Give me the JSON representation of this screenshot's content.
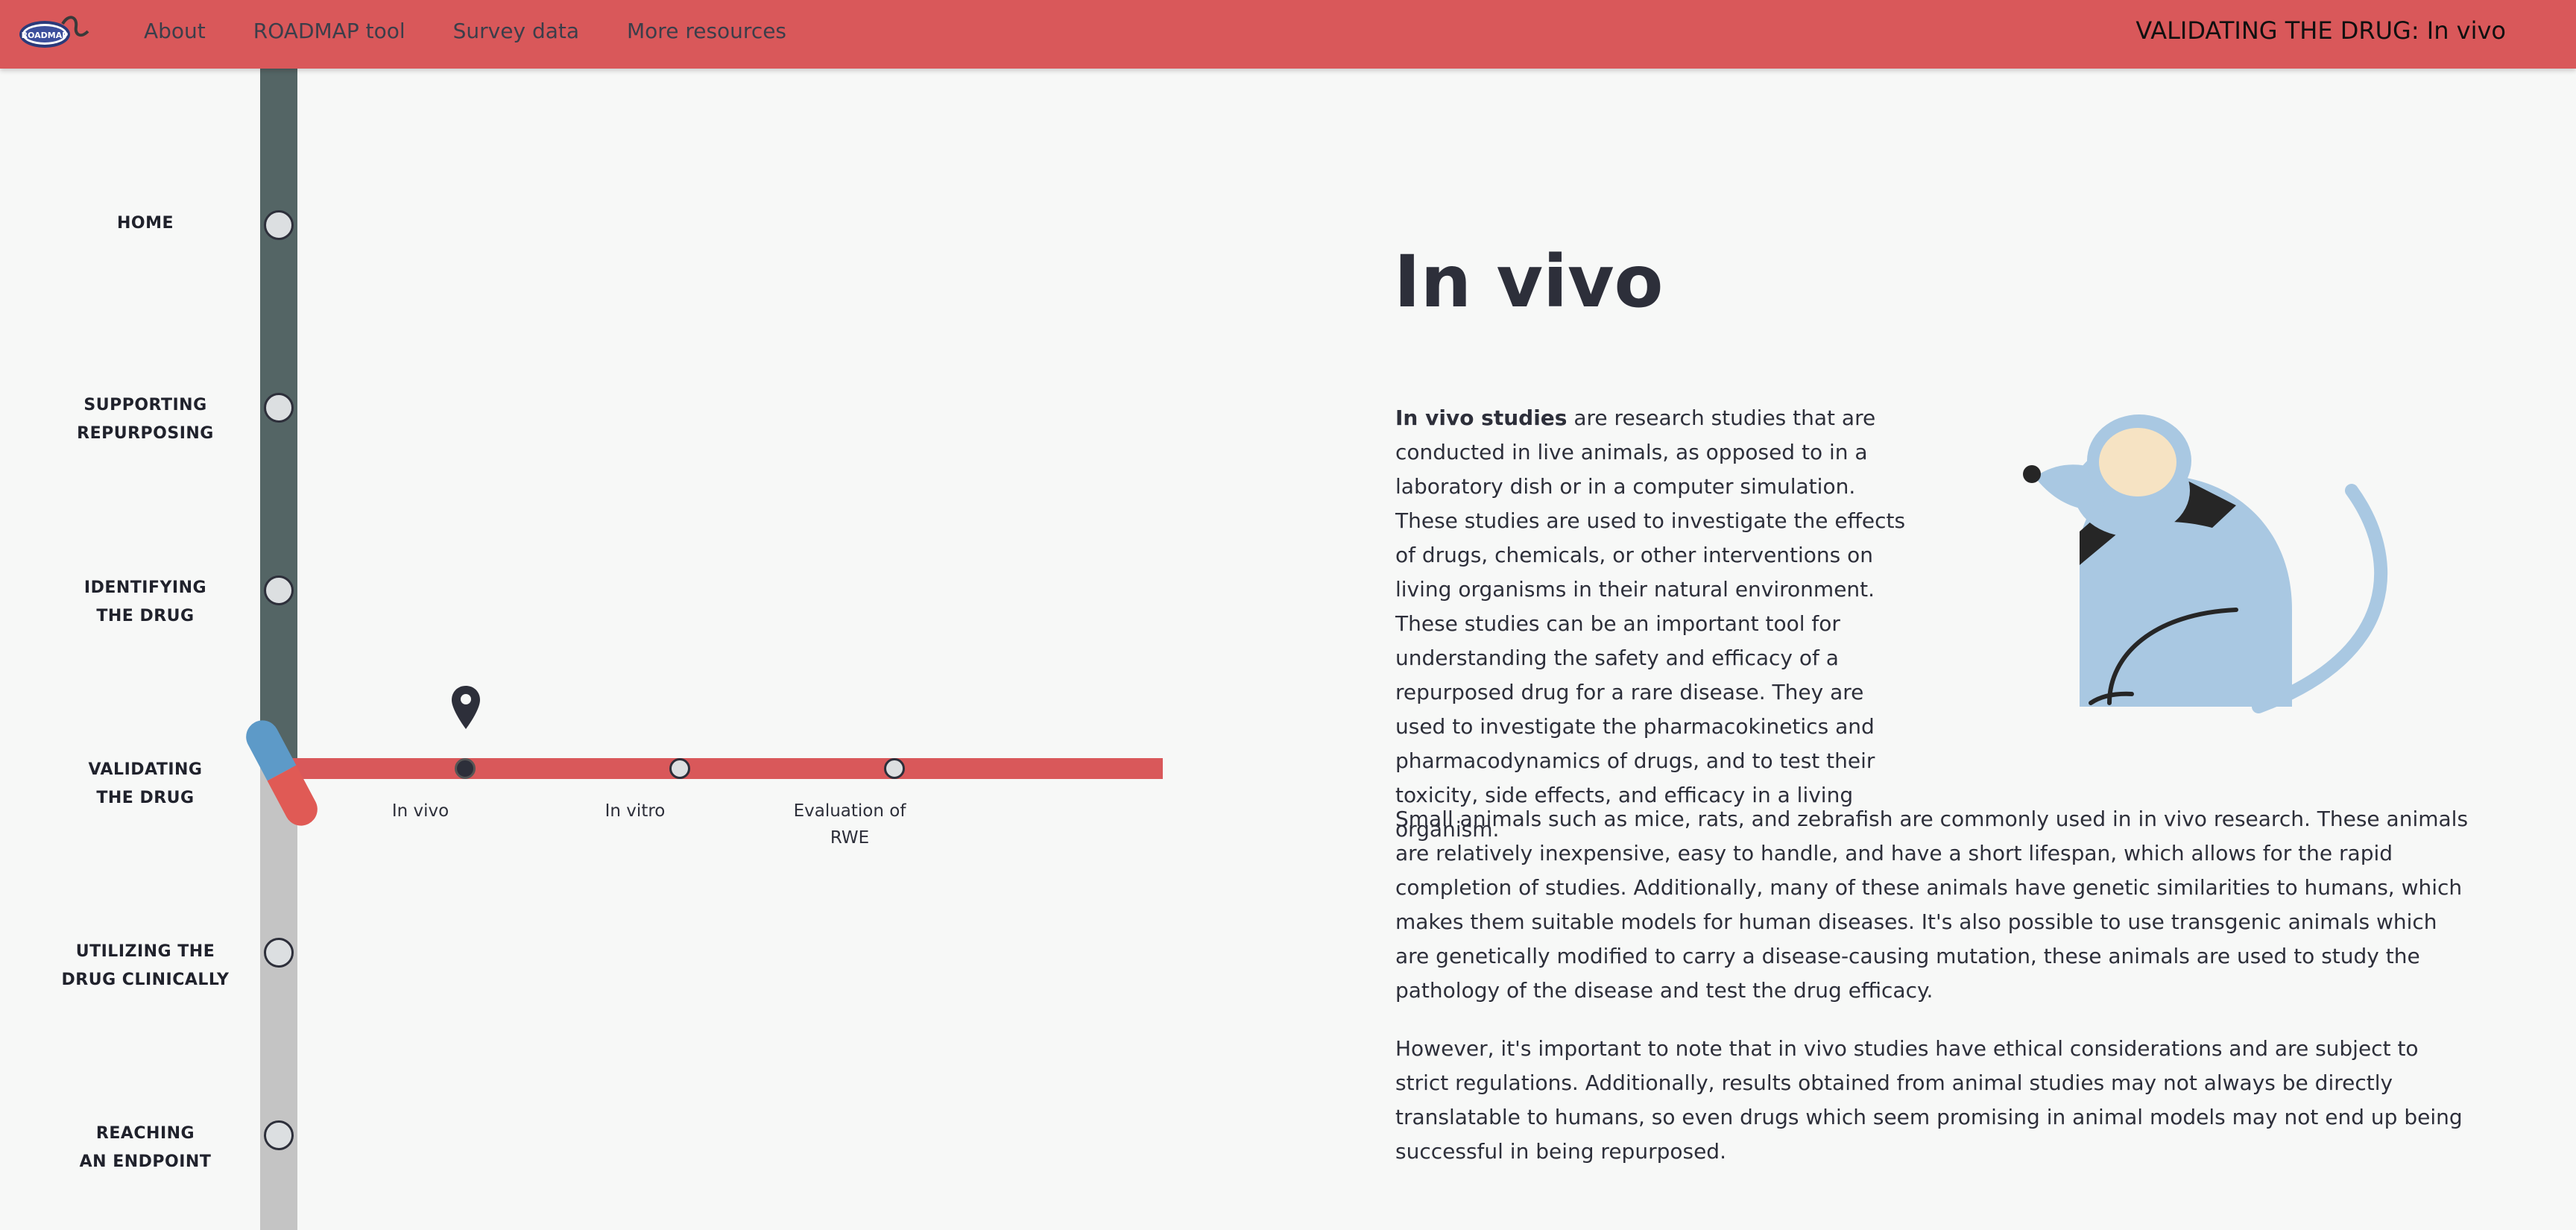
{
  "header": {
    "logo_text": "ROADMAP",
    "nav": [
      "About",
      "ROADMAP tool",
      "Survey data",
      "More resources"
    ],
    "page_heading": "VALIDATING THE DRUG: In vivo"
  },
  "roadmap": {
    "stages": [
      {
        "line1": "HOME",
        "line2": ""
      },
      {
        "line1": "SUPPORTING",
        "line2": "REPURPOSING"
      },
      {
        "line1": "IDENTIFYING",
        "line2": "THE DRUG"
      },
      {
        "line1": "VALIDATING",
        "line2": "THE DRUG"
      },
      {
        "line1": "UTILIZING THE",
        "line2": "DRUG CLINICALLY"
      },
      {
        "line1": "REACHING",
        "line2": "AN ENDPOINT"
      }
    ],
    "current_stage": "VALIDATING THE DRUG",
    "substeps": [
      {
        "line1": "In vivo",
        "line2": ""
      },
      {
        "line1": "In vitro",
        "line2": ""
      },
      {
        "line1": "Evaluation of",
        "line2": "RWE"
      }
    ],
    "active_substep": "In vivo"
  },
  "content": {
    "title": "In vivo",
    "intro_bold": "In vivo studies",
    "intro_rest": " are research studies that are conducted in live animals, as opposed to in a laboratory dish or in a computer simulation. These studies are used to investigate the effects of drugs, chemicals, or other interventions on living organisms in their natural environment. These studies can be an important tool for understanding the safety and efficacy of a repurposed drug for a rare disease. They are used to investigate the pharmacokinetics and pharmacodynamics of drugs, and to test their toxicity, side effects, and efficacy in a living organism.",
    "para2": "Small animals such as mice, rats, and zebrafish are commonly used in in vivo research. These animals are relatively inexpensive, easy to handle, and have a short lifespan, which allows for the rapid completion of studies. Additionally, many of these animals have genetic similarities to humans, which makes them suitable models for human diseases. It's also possible to use transgenic animals which are genetically modified to carry a disease-causing mutation, these animals are used to study the pathology of the disease and test the drug efficacy.",
    "para3": "However, it's important to note that in vivo studies have ethical considerations and are subject to strict regulations. Additionally, results obtained from animal studies may not always be directly translatable to humans, so even drugs which seem promising in animal models may not end up being successful in being repurposed."
  },
  "colors": {
    "topbar": "#d9585a",
    "track_dark": "#546565",
    "track_light": "#c4c4c4",
    "branch": "#d9585a",
    "text": "#2d2f3a",
    "mouse_body": "#a9c8e2",
    "mouse_ear": "#f6e3c3"
  },
  "icons": {
    "logo": "roadmap-logo-icon",
    "pin": "map-pin-icon",
    "pill": "pill-icon",
    "illustration": "mouse-illustration-icon"
  }
}
